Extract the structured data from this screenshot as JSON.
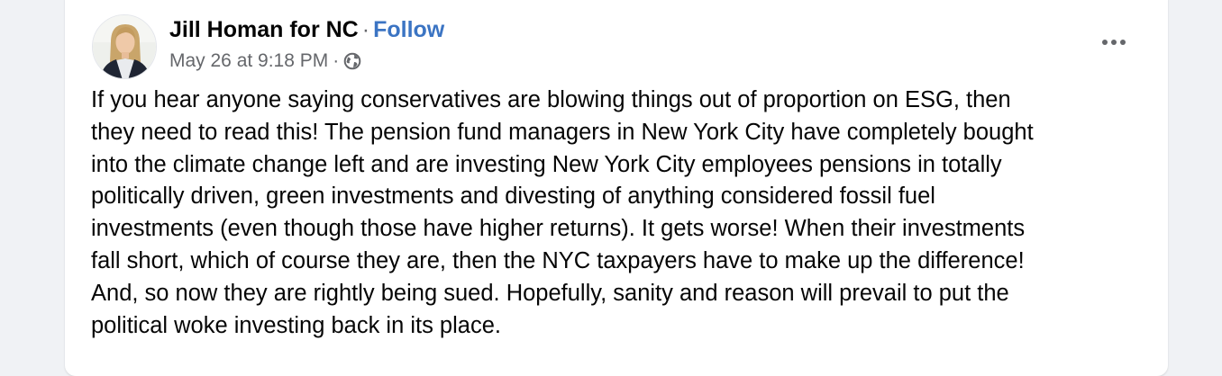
{
  "post": {
    "author": "Jill Homan for NC",
    "separator": "·",
    "follow_label": "Follow",
    "timestamp": "May 26 at 9:18 PM",
    "meta_separator": "·",
    "privacy_icon": "globe-icon",
    "more_icon": "more-options-icon",
    "text_lines": [
      "If you hear anyone saying conservatives are blowing things out of proportion on ESG, then",
      "they need to read this! The pension fund managers in New York City have completely bought",
      "into the climate change left and are investing New York City employees pensions in totally",
      "politically driven, green investments and divesting of anything considered fossil fuel",
      "investments (even though those have higher returns). It gets worse! When their investments",
      "fall short, which of course they are, then the NYC taxpayers have to make up the difference!",
      "And, so now they are rightly being sued. Hopefully, sanity and reason will prevail to put the",
      "political woke investing back in its place."
    ]
  },
  "colors": {
    "background": "#f0f2f5",
    "card": "#ffffff",
    "follow_link": "#3b74c3",
    "secondary_text": "#65676b",
    "primary_text": "#050505"
  }
}
